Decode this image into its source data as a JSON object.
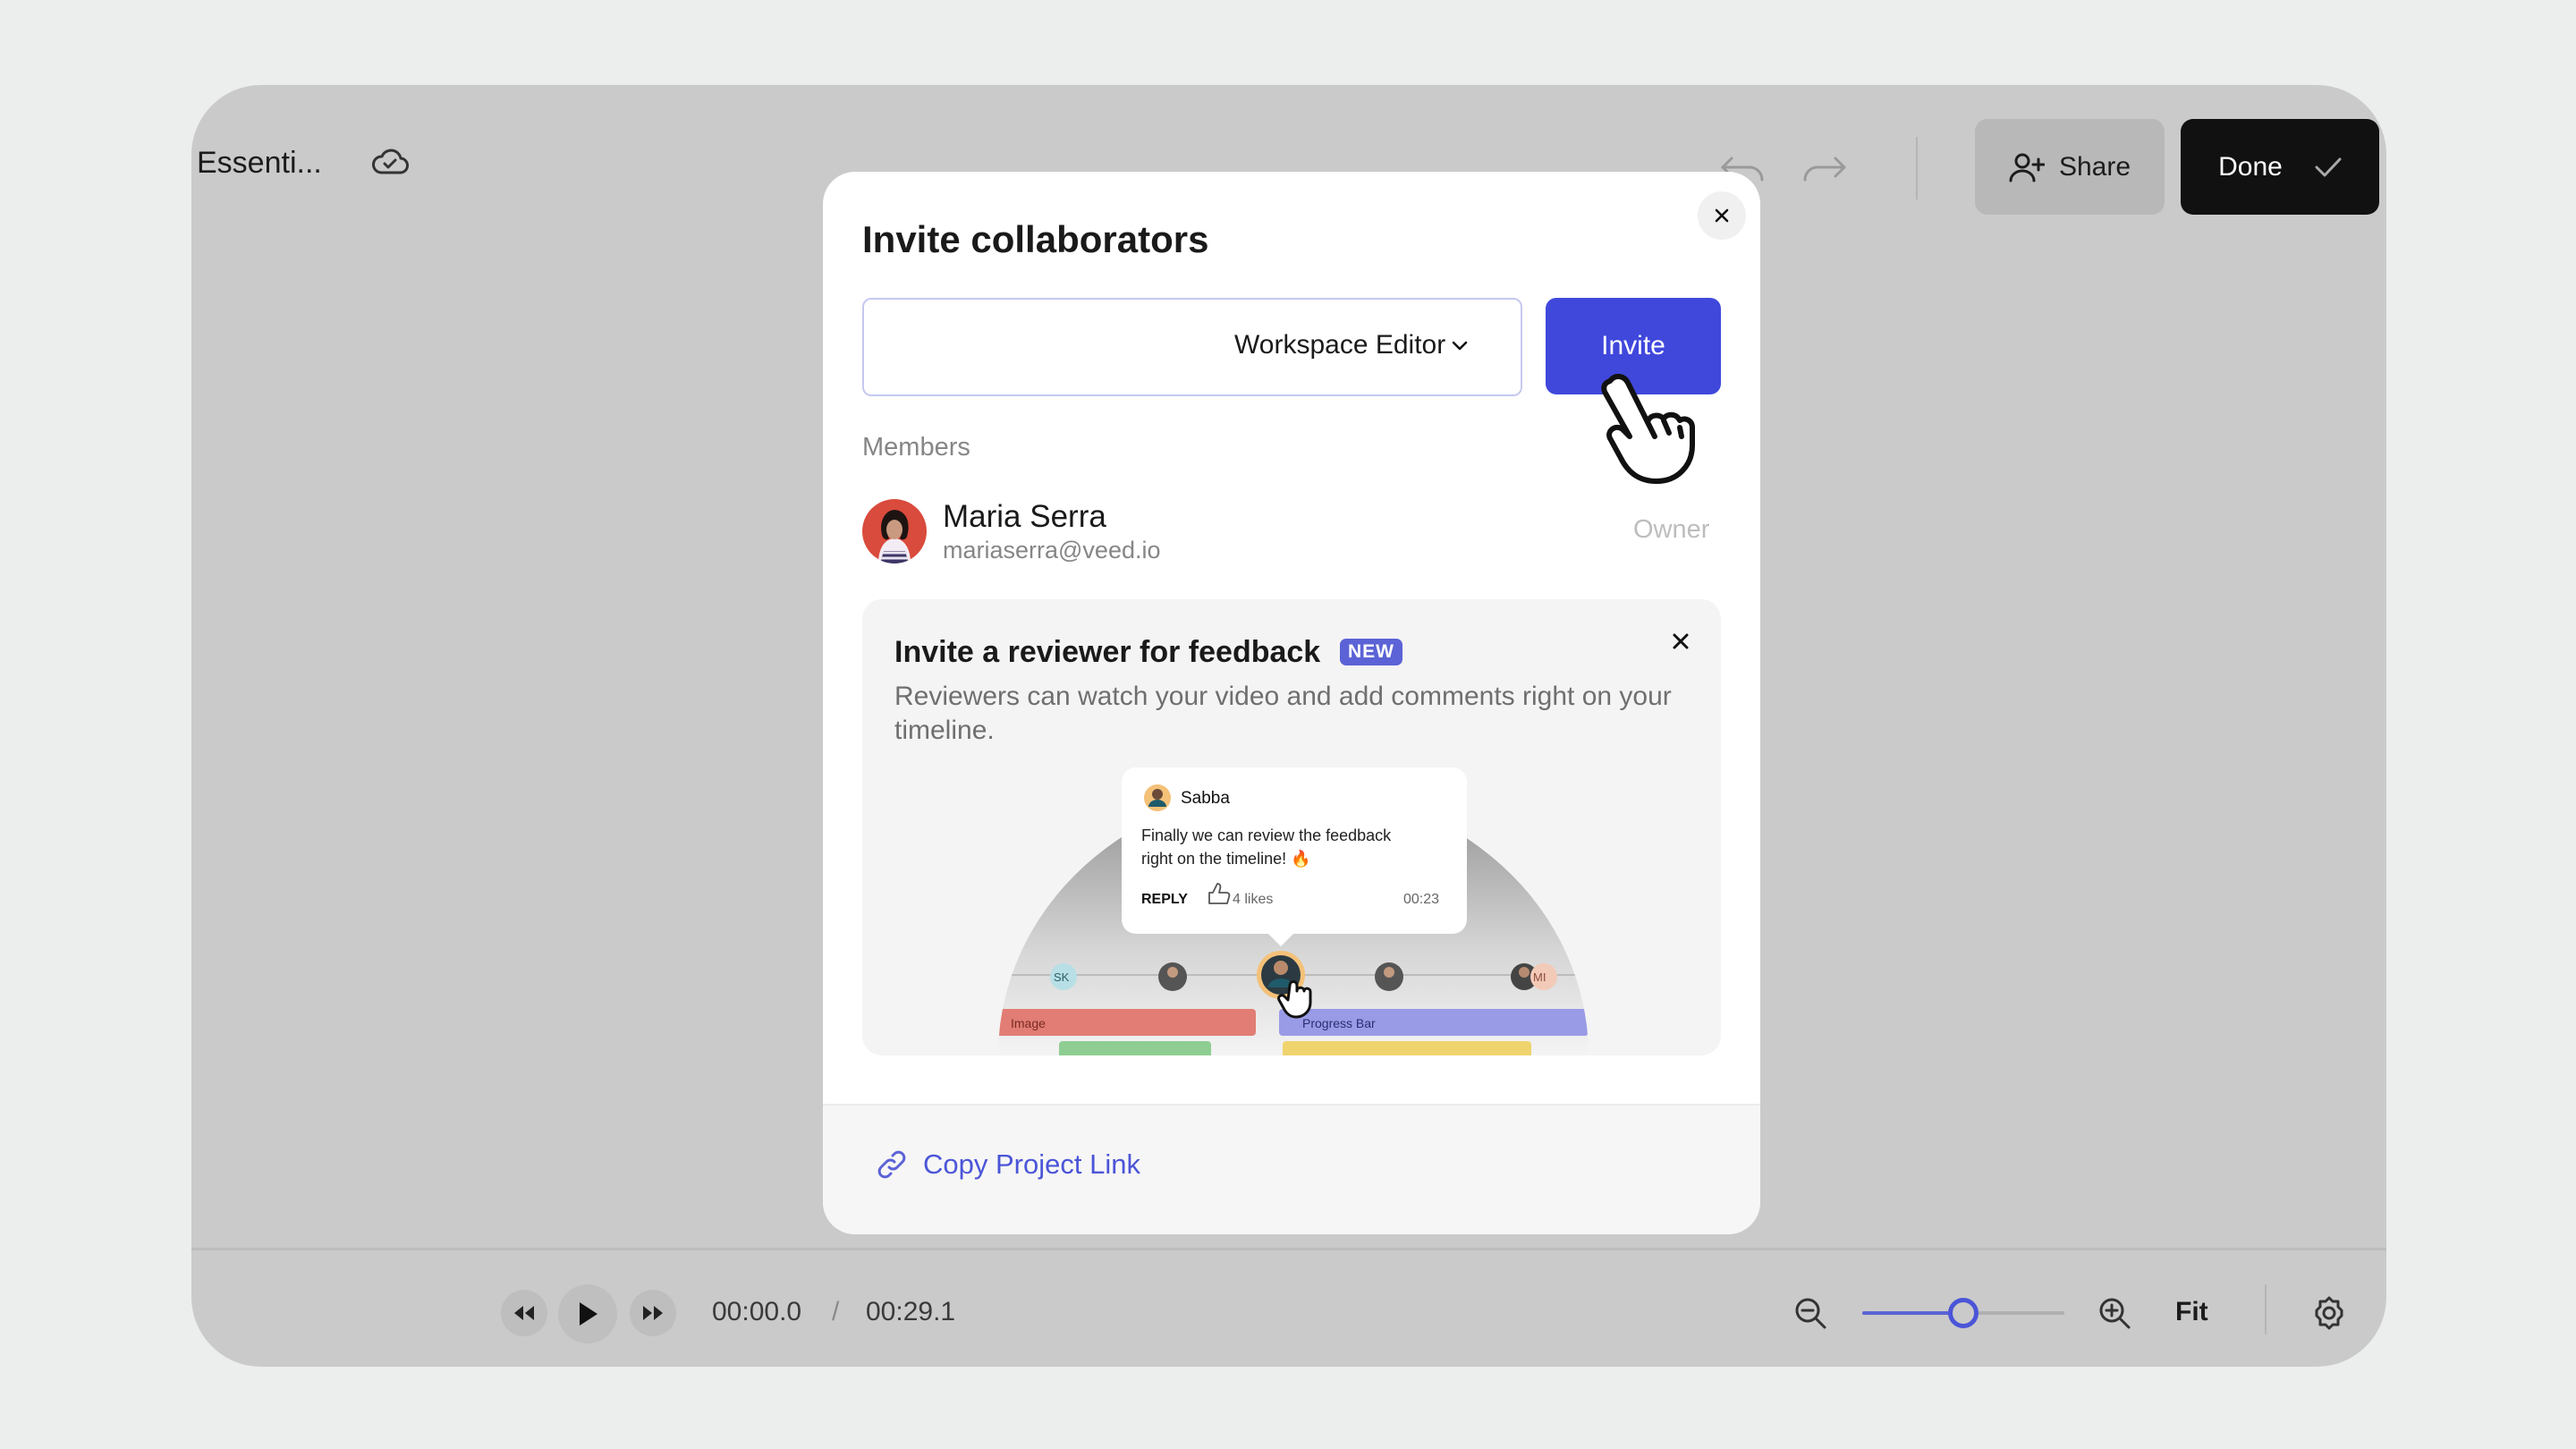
{
  "header": {
    "project_title": "Essenti...",
    "share_label": "Share",
    "done_label": "Done"
  },
  "player": {
    "current_time": "00:00.0",
    "separator": "/",
    "total_time": "00:29.1",
    "zoom_fraction": 0.5,
    "fit_label": "Fit"
  },
  "modal": {
    "title": "Invite collaborators",
    "email_placeholder": "",
    "role_select": "Workspace Editor",
    "invite_label": "Invite",
    "members_label": "Members",
    "members": [
      {
        "name": "Maria Serra",
        "email": "mariaserra@veed.io",
        "role": "Owner"
      }
    ],
    "promo": {
      "title": "Invite a reviewer for feedback",
      "badge": "NEW",
      "description": "Reviewers can watch your video and add comments right on your timeline.",
      "comment_author": "Sabba",
      "comment_text_1": "Finally we can review the feedback",
      "comment_text_2": "right on the timeline! 🔥",
      "reply_label": "REPLY",
      "likes": "4 likes",
      "comment_time": "00:23",
      "avatar_sk": "SK",
      "avatar_mi": "MI",
      "track_image": "Image",
      "track_progress": "Progress Bar"
    },
    "copy_link_label": "Copy Project Link"
  },
  "colors": {
    "accent": "#4048dc",
    "done_bg": "#111111",
    "backdrop": "#cacaca"
  }
}
